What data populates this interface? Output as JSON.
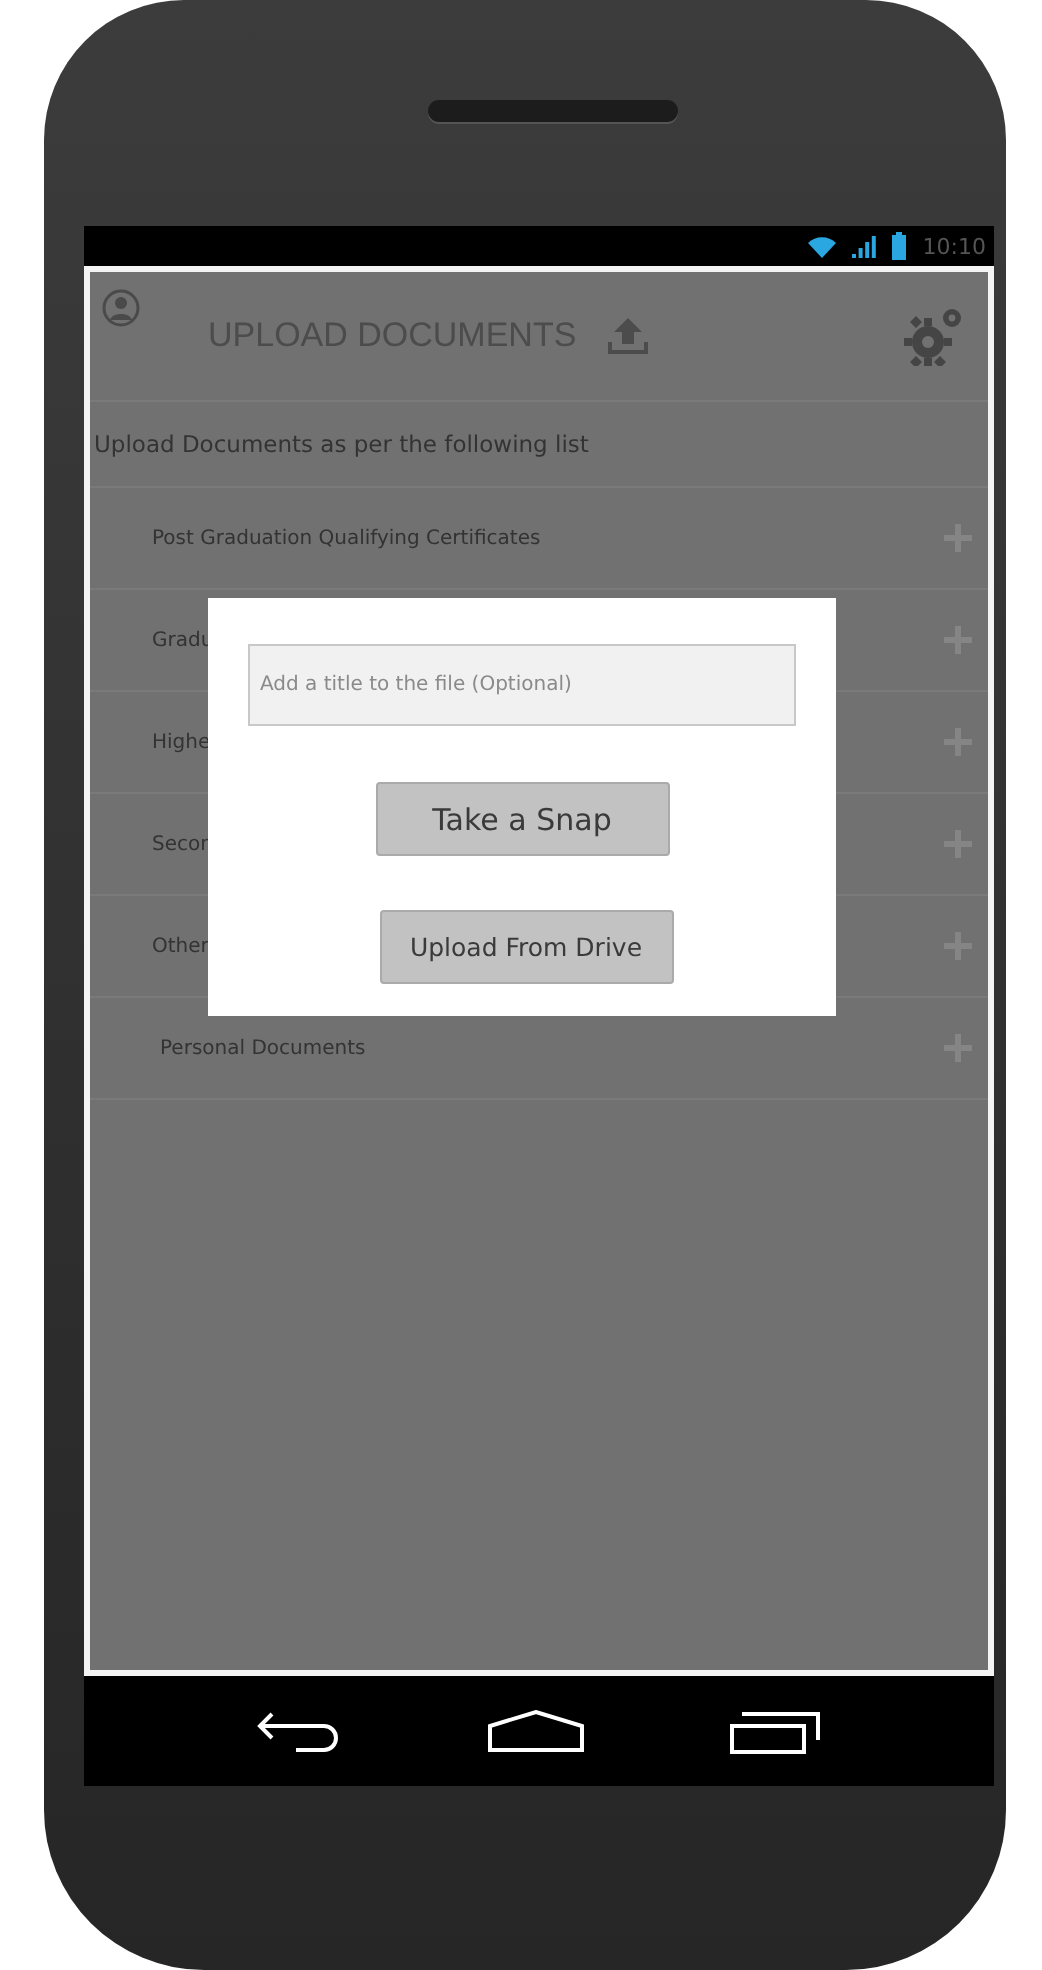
{
  "status_bar": {
    "time": "10:10"
  },
  "header": {
    "title": "UPLOAD DOCUMENTS"
  },
  "intro": "Upload Documents as per the following list",
  "documents": [
    {
      "label": "Post Graduation Qualifying Certificates"
    },
    {
      "label": "Gradu"
    },
    {
      "label": "Highe"
    },
    {
      "label": "Secon"
    },
    {
      "label": "Other"
    },
    {
      "label": "Personal Documents"
    }
  ],
  "dialog": {
    "title_field": {
      "placeholder": "Add a title to the file (Optional)"
    },
    "buttons": [
      "Take a Snap",
      "Upload From Drive"
    ]
  }
}
